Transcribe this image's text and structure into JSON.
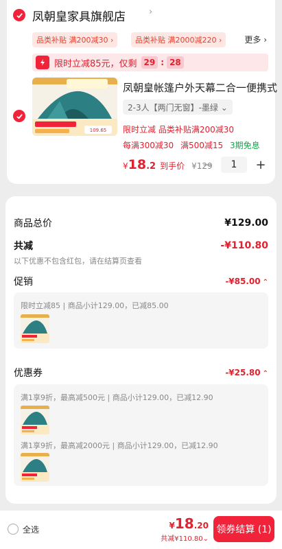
{
  "store": {
    "name": "凤朝皇家具旗舰店",
    "arrow": "›",
    "chips": [
      "品类补贴 满200减30 ›",
      "品类补贴 满2000减220 ›"
    ],
    "more": "更多 ›",
    "flash": {
      "text": "限时立减85元，仅剩",
      "minutes": "29",
      "seconds": "28"
    }
  },
  "product": {
    "title": "凤朝皇帐篷户外天幕二合一便携式",
    "variant": "2-3人【两门无窗】-墨绿 ⌄",
    "promo1": "限时立减  品类补贴满200减30",
    "promo2_a": "每满300减30",
    "promo2_b": "满500减15",
    "promo2_c": "3期免息",
    "price_yen": "¥",
    "price_int": "18",
    "price_dec": ".2",
    "price_label": "到手价",
    "price_orig": "¥129",
    "qty_minus": "−",
    "qty": "1",
    "qty_plus": "+"
  },
  "summary": {
    "total_label": "商品总价",
    "total_val": "¥129.00",
    "discount_label": "共减",
    "discount_val": "-¥110.80",
    "note": "以下优惠不包含红包，请在结算页查看",
    "promo_label": "促销",
    "promo_val": "-¥85.00",
    "promo_detail": "限时立减85 | 商品小计129.00，已减85.00",
    "coupon_label": "优惠券",
    "coupon_val": "-¥25.80",
    "coupon_detail1": "满1享9折，最高减500元 | 商品小计129.00，已减12.90",
    "coupon_detail2": "满1享9折，最高减2000元 | 商品小计129.00，已减12.90",
    "caret": "⌃"
  },
  "bottom": {
    "select_all": "全选",
    "total_yen": "¥",
    "total_int": "18",
    "total_dec": ".20",
    "saved": "共减¥110.80⌄",
    "checkout": "领券结算 (1)"
  },
  "colors": {
    "accent": "#f0233a",
    "price_red": "#e0212f",
    "green": "#17a34a"
  }
}
